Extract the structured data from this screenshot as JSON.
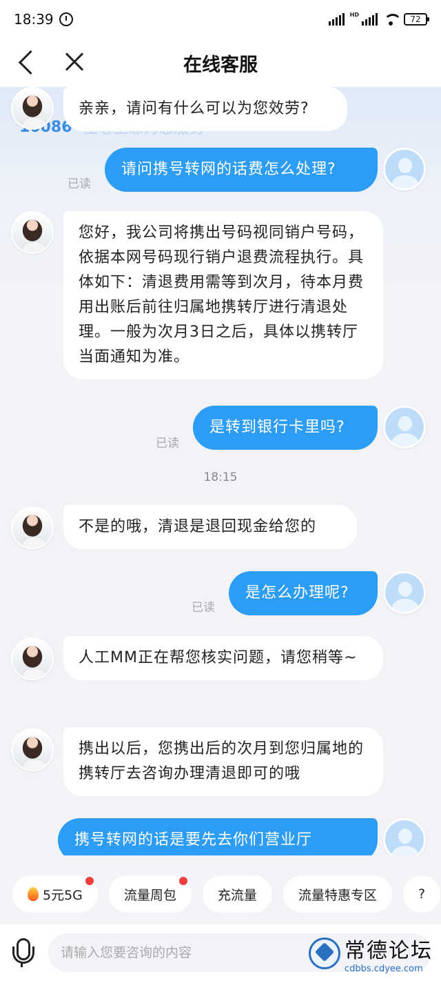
{
  "status_bar": {
    "time": "18:39",
    "battery": "72",
    "hd_label": "HD"
  },
  "header": {
    "title": "在线客服"
  },
  "banner": {
    "number": "10086",
    "slogan": "全心全意为您服务"
  },
  "messages": [
    {
      "sender": "agent",
      "text": "亲亲，请问有什么可以为您效劳?"
    },
    {
      "sender": "user",
      "text": "请问携号转网的话费怎么处理?",
      "status": "已读"
    },
    {
      "sender": "agent",
      "text": "您好，我公司将携出号码视同销户号码，依据本网号码现行销户退费流程执行。具体如下：清退费用需等到次月，待本月费用出账后前往归属地携转厅进行清退处理。一般为次月3日之后，具体以携转厅当面通知为准。"
    },
    {
      "sender": "user",
      "text": "是转到银行卡里吗?",
      "status": "已读"
    },
    {
      "sender": "timestamp",
      "text": "18:15"
    },
    {
      "sender": "agent",
      "text": "不是的哦，清退是退回现金给您的"
    },
    {
      "sender": "user",
      "text": "是怎么办理呢?",
      "status": "已读"
    },
    {
      "sender": "agent",
      "text": "人工MM正在帮您核实问题，请您稍等~"
    },
    {
      "sender": "agent",
      "text": "携出以后，您携出后的次月到您归属地的携转厅去咨询办理清退即可的哦"
    },
    {
      "sender": "user",
      "text": "携号转网的话是要先去你们营业厅"
    }
  ],
  "quick_chips": [
    {
      "label": "5元5G",
      "badge": true,
      "icon": "fire-icon"
    },
    {
      "label": "流量周包",
      "badge": true
    },
    {
      "label": "充流量",
      "badge": false
    },
    {
      "label": "流量特惠专区",
      "badge": false
    },
    {
      "label": "?",
      "badge": false
    }
  ],
  "input": {
    "placeholder": "请输入您要咨询的内容"
  },
  "watermark": {
    "title": "常德论坛",
    "url": "cdbbs.cdyee.com"
  },
  "colors": {
    "accent": "#2d9cf5",
    "background": "#f2f3f7",
    "badge": "#f03c3c"
  }
}
